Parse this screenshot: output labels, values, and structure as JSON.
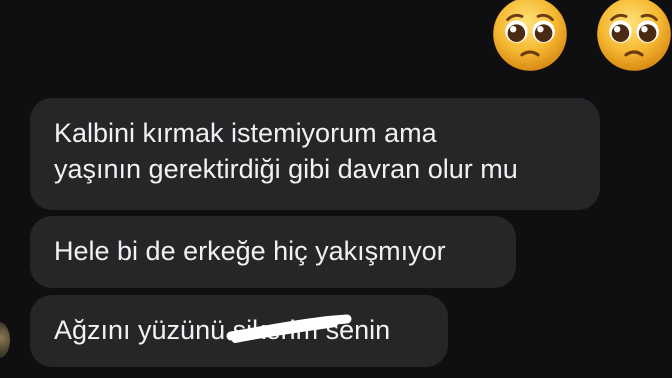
{
  "header": {
    "reactions": [
      "pleading-face-emoji",
      "pleading-face-emoji"
    ]
  },
  "messages": [
    {
      "lines": [
        "Kalbini kırmak istemiyorum ama",
        "yaşının gerektirdiği gibi davran olur mu"
      ]
    },
    {
      "lines": [
        "Hele bi de erkeğe hiç yakışmıyor"
      ]
    },
    {
      "prefix": "Ağzını yüzünü ",
      "redacted": "sikerim",
      "suffix": " senin"
    }
  ],
  "colors": {
    "background": "#0f0f12",
    "bubble": "#262629",
    "text": "#f1f1f3",
    "emoji_face": "#f6b932"
  }
}
